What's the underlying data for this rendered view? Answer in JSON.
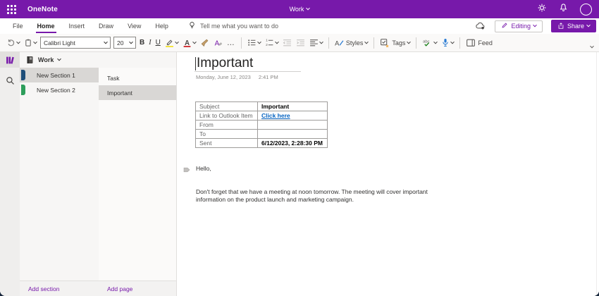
{
  "titlebar": {
    "app_name": "OneNote",
    "notebook_switcher": "Work"
  },
  "menubar": {
    "tabs": [
      {
        "label": "File"
      },
      {
        "label": "Home"
      },
      {
        "label": "Insert"
      },
      {
        "label": "Draw"
      },
      {
        "label": "View"
      },
      {
        "label": "Help"
      }
    ],
    "active_tab": "Home",
    "tellme_placeholder": "Tell me what you want to do",
    "editing_label": "Editing",
    "share_label": "Share"
  },
  "toolbar": {
    "font_name": "Calibri Light",
    "font_size": "20",
    "bold": "B",
    "italic": "I",
    "underline": "U",
    "overflow": "…",
    "styles_label": "Styles",
    "tags_label": "Tags",
    "feed_label": "Feed"
  },
  "sidebar": {
    "notebook_name": "Work",
    "sections": [
      {
        "name": "New Section 1",
        "color": "#1e4e79",
        "selected": true
      },
      {
        "name": "New Section 2",
        "color": "#2e9e5b",
        "selected": false
      }
    ],
    "pages": [
      {
        "name": "Task",
        "selected": false
      },
      {
        "name": "Important",
        "selected": true
      }
    ],
    "add_section": "Add section",
    "add_page": "Add page"
  },
  "page": {
    "title": "Important",
    "date": "Monday, June 12, 2023",
    "time": "2:41 PM",
    "table": {
      "rows": [
        {
          "label": "Subject",
          "value": "Important"
        },
        {
          "label": "Link to Outlook Item",
          "value": "Click here"
        },
        {
          "label": "From",
          "value": ""
        },
        {
          "label": "To",
          "value": ""
        },
        {
          "label": "Sent",
          "value": "6/12/2023, 2:28:30 PM"
        }
      ]
    },
    "greeting": "Hello,",
    "body": "Don't forget that we have a meeting at noon tomorrow. The meeting will cover important information on the product launch and marketing campaign."
  },
  "colors": {
    "brand_purple": "#7719aa",
    "link_blue": "#0563c1",
    "selected_gray": "#d9d7d5",
    "section1_marker": "#1e4e79",
    "section2_marker": "#2e9e5b"
  }
}
